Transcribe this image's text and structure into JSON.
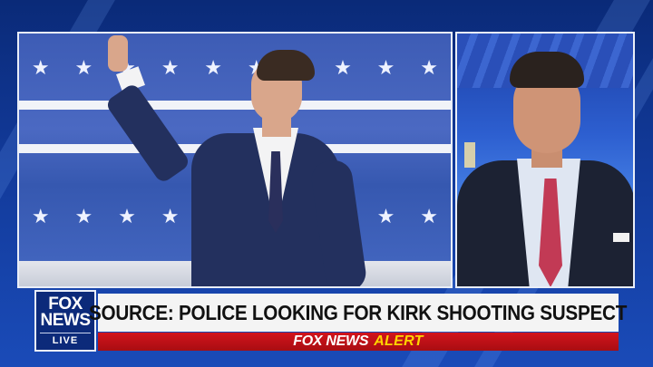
{
  "logo": {
    "line1": "FOX",
    "line2": "NEWS",
    "status": "LIVE"
  },
  "headline": "SOURCE: POLICE LOOKING FOR KIRK SHOOTING SUSPECT",
  "alert": {
    "brand": "FOX NEWS",
    "word": "ALERT"
  },
  "colors": {
    "alert_red": "#c8141b",
    "alert_yellow": "#ffd400",
    "logo_blue": "#0c2a7a",
    "bg_blue": "#123a9a"
  }
}
